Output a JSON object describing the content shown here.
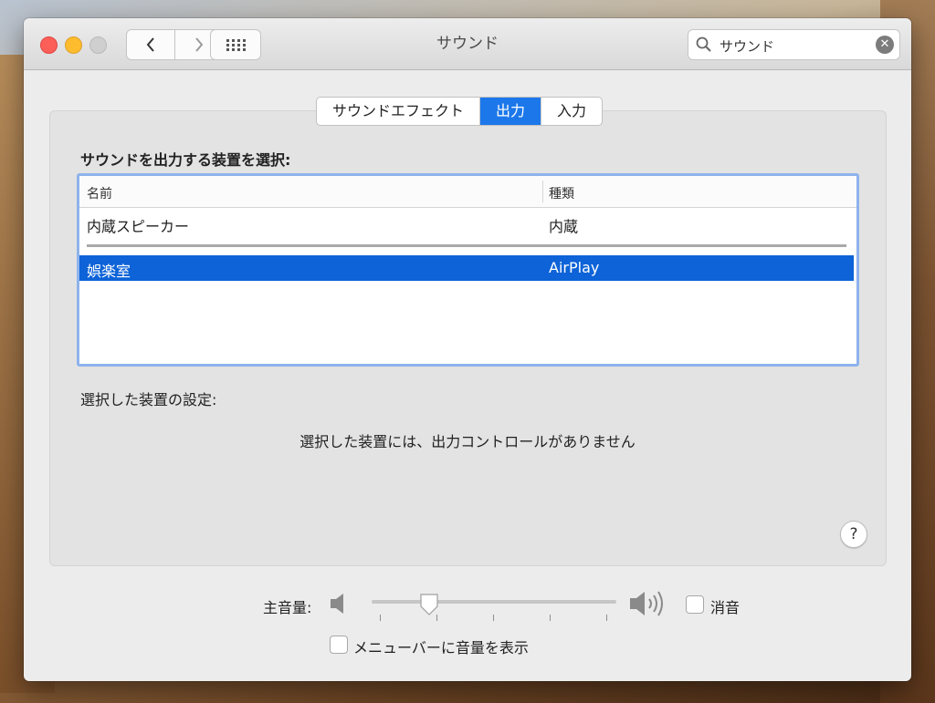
{
  "window": {
    "title": "サウンド"
  },
  "search": {
    "value": "サウンド"
  },
  "tabs": [
    {
      "label": "サウンドエフェクト",
      "active": false
    },
    {
      "label": "出力",
      "active": true
    },
    {
      "label": "入力",
      "active": false
    }
  ],
  "output": {
    "heading": "サウンドを出力する装置を選択:",
    "columns": {
      "name": "名前",
      "type": "種類"
    },
    "devices": [
      {
        "name": "内蔵スピーカー",
        "type": "内蔵",
        "selected": false
      },
      {
        "name": "娯楽室",
        "type": "AirPlay",
        "selected": true
      }
    ],
    "settings_label": "選択した装置の設定:",
    "no_controls_text": "選択した装置には、出力コントロールがありません"
  },
  "help_label": "?",
  "volume": {
    "label": "主音量:",
    "level": 0.21,
    "mute_label": "消音",
    "mute_checked": false,
    "show_in_menubar_label": "メニューバーに音量を表示",
    "show_in_menubar_checked": false
  },
  "colors": {
    "accent": "#1c78ea",
    "selection": "#0d63d7",
    "close": "#fc5f57",
    "minimize": "#fdbc2e"
  }
}
